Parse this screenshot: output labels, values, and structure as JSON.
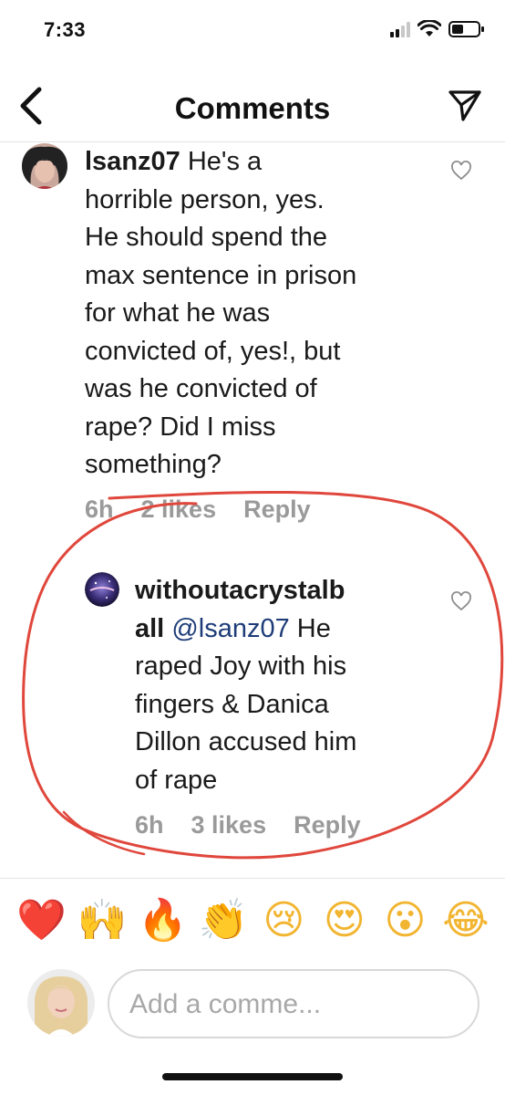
{
  "status_bar": {
    "time": "7:33",
    "icons": [
      "cellular-signal-icon",
      "wifi-icon",
      "battery-icon"
    ]
  },
  "nav": {
    "title": "Comments",
    "back_icon": "chevron-left-icon",
    "share_icon": "paper-plane-icon"
  },
  "comments": [
    {
      "username": "lsanz07",
      "text": " He's a horrible person, yes. He should spend the max sentence in prison for what he was convicted of, yes!, but was he convicted of rape? Did I miss something?",
      "lines": [
        "He's a",
        "horrible person, yes.",
        "He should spend the",
        "max sentence in prison",
        "for what he was",
        "convicted of, yes!, but",
        "was he convicted of",
        "rape? Did I miss",
        "something?"
      ],
      "time": "6h",
      "likes": "2 likes",
      "reply": "Reply"
    },
    {
      "username_line1": "withoutacrystalb",
      "username_line2": "all",
      "mention": "@lsanz07",
      "lines": [
        "He",
        "raped Joy with his",
        "fingers & Danica",
        "Dillon accused him",
        "of rape"
      ],
      "time": "6h",
      "likes": "3 likes",
      "reply": "Reply"
    }
  ],
  "reactions": [
    "❤️",
    "🙌",
    "🔥",
    "👏",
    "😢",
    "😍",
    "😮",
    "😂"
  ],
  "composer": {
    "placeholder": "Add a comme..."
  },
  "colors": {
    "annotation_red": "#e0473c",
    "mention_blue": "#1d3c78",
    "meta_gray": "#9a9a9a"
  }
}
